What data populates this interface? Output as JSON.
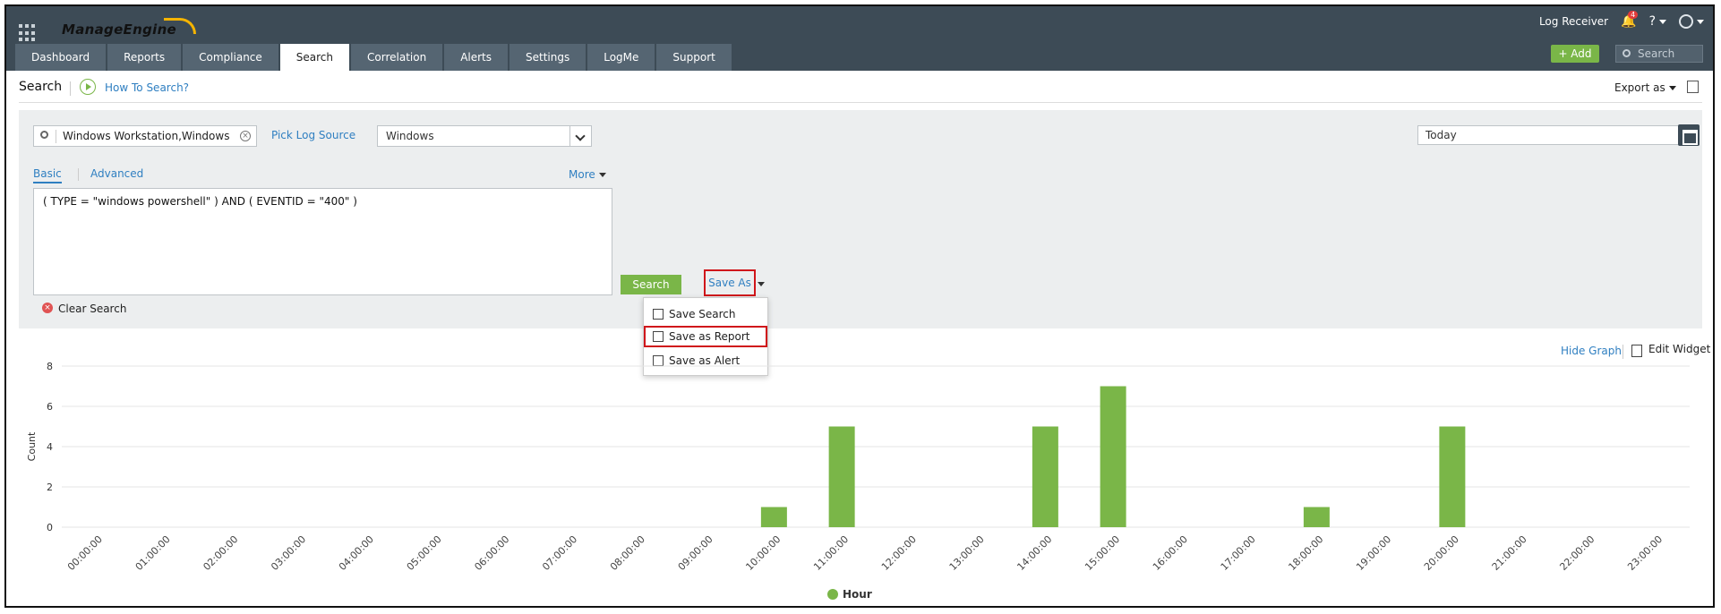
{
  "header": {
    "logo": "ManageEngine",
    "product": "Log Receiver",
    "alert_count": "4",
    "help": "?",
    "nav_tabs": [
      {
        "label": "Dashboard"
      },
      {
        "label": "Reports"
      },
      {
        "label": "Compliance"
      },
      {
        "label": "Search",
        "active": true
      },
      {
        "label": "Correlation"
      },
      {
        "label": "Alerts"
      },
      {
        "label": "Settings"
      },
      {
        "label": "LogMe"
      },
      {
        "label": "Support"
      }
    ],
    "add_label": "+ Add",
    "search_placeholder": "Search"
  },
  "subheader": {
    "title": "Search",
    "how_to": "How To Search?",
    "export_label": "Export as"
  },
  "query": {
    "log_source_value": "Windows Workstation,Windows",
    "pick_source_label": "Pick Log Source",
    "device_type": "Windows",
    "date_range": "Today",
    "mode_basic": "Basic",
    "mode_advanced": "Advanced",
    "more_label": "More",
    "query_text": "( TYPE = \"windows powershell\" ) AND ( EVENTID = \"400\" )",
    "search_button": "Search",
    "save_as_label": "Save As",
    "clear_label": "Clear Search"
  },
  "save_menu": {
    "items": [
      {
        "label": "Save Search"
      },
      {
        "label": "Save as Report",
        "highlighted": true
      },
      {
        "label": "Save as Alert"
      }
    ]
  },
  "graph_controls": {
    "hide_graph": "Hide Graph",
    "edit_widget": "Edit Widget"
  },
  "chart_data": {
    "type": "bar",
    "ylabel": "Count",
    "xlabel": "",
    "ylim": [
      0,
      8
    ],
    "yticks": [
      0,
      2,
      4,
      6,
      8
    ],
    "grid": true,
    "legend": "bottom-center",
    "color": "#7ab648",
    "categories": [
      "00:00:00",
      "01:00:00",
      "02:00:00",
      "03:00:00",
      "04:00:00",
      "05:00:00",
      "06:00:00",
      "07:00:00",
      "08:00:00",
      "09:00:00",
      "10:00:00",
      "11:00:00",
      "12:00:00",
      "13:00:00",
      "14:00:00",
      "15:00:00",
      "16:00:00",
      "17:00:00",
      "18:00:00",
      "19:00:00",
      "20:00:00",
      "21:00:00",
      "22:00:00",
      "23:00:00"
    ],
    "series": [
      {
        "name": "Hour",
        "values": [
          0,
          0,
          0,
          0,
          0,
          0,
          0,
          0,
          0,
          0,
          1,
          5,
          0,
          0,
          5,
          7,
          0,
          0,
          1,
          0,
          5,
          0,
          0,
          0
        ]
      }
    ]
  }
}
